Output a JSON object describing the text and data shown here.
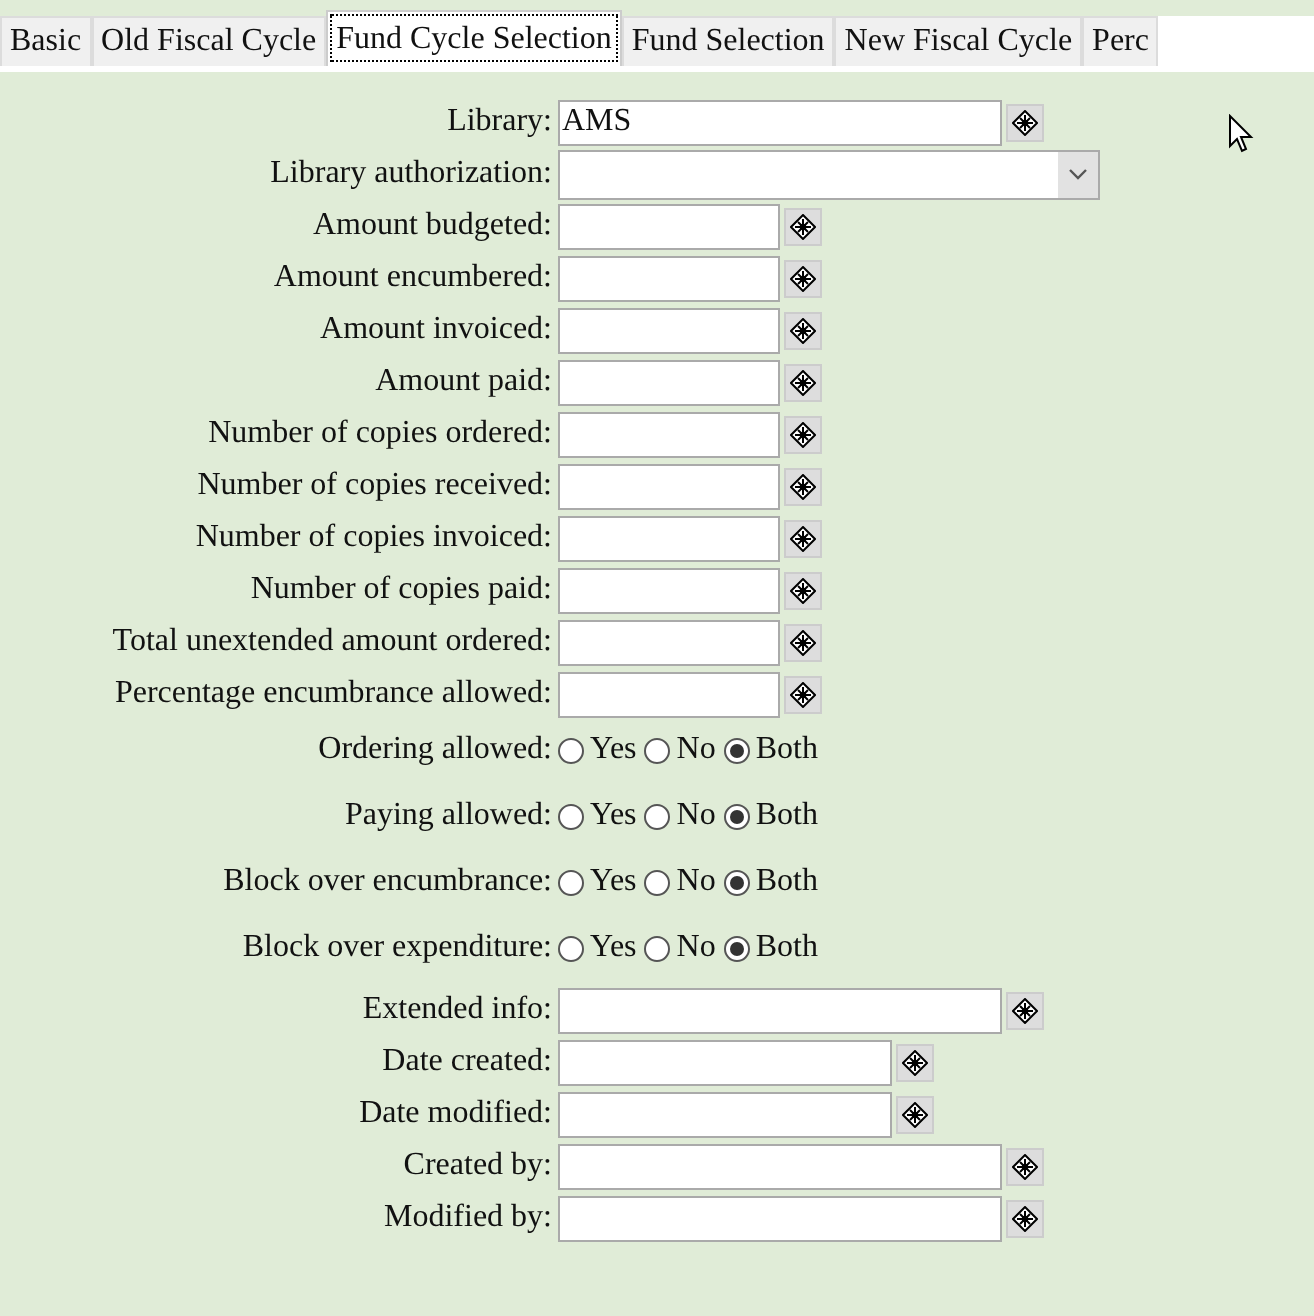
{
  "tabs": [
    {
      "label": "Basic",
      "selected": false
    },
    {
      "label": "Old Fiscal Cycle",
      "selected": false
    },
    {
      "label": "Fund Cycle Selection",
      "selected": true
    },
    {
      "label": "Fund Selection",
      "selected": false
    },
    {
      "label": "New Fiscal Cycle",
      "selected": false
    },
    {
      "label": "Perc",
      "selected": false
    }
  ],
  "fields": [
    {
      "kind": "long",
      "label": "Library:",
      "value": "AMS"
    },
    {
      "kind": "select",
      "label": "Library authorization:"
    },
    {
      "kind": "short",
      "label": "Amount budgeted:"
    },
    {
      "kind": "short",
      "label": "Amount encumbered:"
    },
    {
      "kind": "short",
      "label": "Amount invoiced:"
    },
    {
      "kind": "short",
      "label": "Amount paid:"
    },
    {
      "kind": "short",
      "label": "Number of copies ordered:"
    },
    {
      "kind": "short",
      "label": "Number of copies received:"
    },
    {
      "kind": "short",
      "label": "Number of copies invoiced:"
    },
    {
      "kind": "short",
      "label": "Number of copies paid:"
    },
    {
      "kind": "short",
      "label": "Total unextended amount ordered:"
    },
    {
      "kind": "short",
      "label": "Percentage encumbrance allowed:"
    },
    {
      "kind": "radio",
      "label": "Ordering allowed:",
      "options": [
        {
          "label": "Yes",
          "selected": false
        },
        {
          "label": "No",
          "selected": false
        },
        {
          "label": "Both",
          "selected": true
        }
      ]
    },
    {
      "kind": "radio",
      "label": "Paying allowed:",
      "options": [
        {
          "label": "Yes",
          "selected": false
        },
        {
          "label": "No",
          "selected": false
        },
        {
          "label": "Both",
          "selected": true
        }
      ]
    },
    {
      "kind": "radio",
      "label": "Block over encumbrance:",
      "options": [
        {
          "label": "Yes",
          "selected": false
        },
        {
          "label": "No",
          "selected": false
        },
        {
          "label": "Both",
          "selected": true
        }
      ]
    },
    {
      "kind": "radio",
      "label": "Block over expenditure:",
      "options": [
        {
          "label": "Yes",
          "selected": false
        },
        {
          "label": "No",
          "selected": false
        },
        {
          "label": "Both",
          "selected": true
        }
      ]
    },
    {
      "kind": "long",
      "label": "Extended info:"
    },
    {
      "kind": "medium",
      "label": "Date created:"
    },
    {
      "kind": "medium",
      "label": "Date modified:"
    },
    {
      "kind": "long",
      "label": "Created by:"
    },
    {
      "kind": "long",
      "label": "Modified by:"
    }
  ]
}
